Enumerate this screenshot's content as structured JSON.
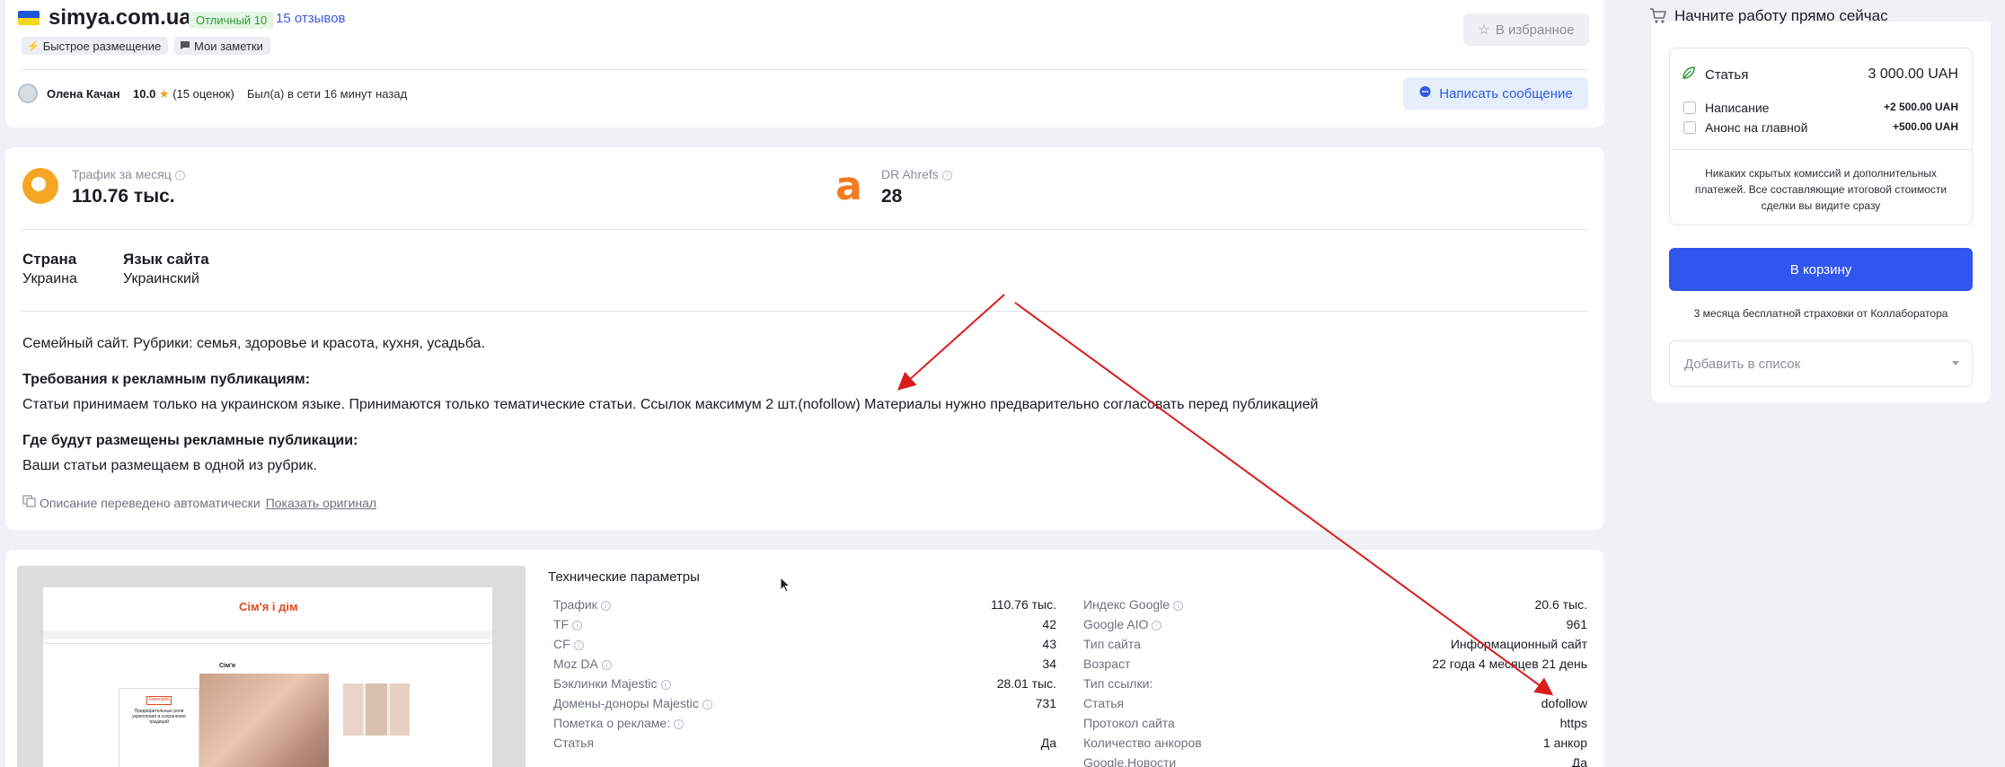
{
  "header": {
    "site_name": "simya.com.ua",
    "rating_badge": "Отличный 10",
    "reviews_link": "15 отзывов",
    "tags": [
      "Быстрое размещение",
      "Мои заметки"
    ],
    "favorite_label": "В избранное",
    "owner": {
      "name": "Олена Качан",
      "rating": "10.0",
      "rating_count": "(15 оценок)",
      "last_seen": "Был(а) в сети 16 минут назад"
    },
    "message_label": "Написать сообщение"
  },
  "metrics": {
    "traffic_label": "Трафик за месяц",
    "traffic_value": "110.76 тыс.",
    "dr_label": "DR Ahrefs",
    "dr_value": "28"
  },
  "site_info": {
    "country_label": "Страна",
    "country_value": "Украина",
    "language_label": "Язык сайта",
    "language_value": "Украинский"
  },
  "description": {
    "about": "Семейный сайт. Рубрики: семья, здоровье и красота, кухня, усадьба.",
    "requirements_title": "Требования к рекламным публикациям:",
    "requirements_text": "Статьи принимаем только на украинском языке. Принимаются только тематические статьи. Ссылок максимум 2 шт.(nofollow) Материалы нужно предварительно согласовать перед публикацией",
    "placement_title": "Где будут размещены рекламные публикации:",
    "placement_text": "Ваши статьи размещаем в одной из рубрик.",
    "translated_note": "Описание переведено автоматически",
    "show_original": "Показать оригинал"
  },
  "preview": {
    "logo_text": "Сім'я і дім",
    "section_title": "Сім'я",
    "article_title": "Предварительные роли укрепления и сохранение традиций",
    "small_label": "Категорія"
  },
  "tech": {
    "title": "Технические параметры",
    "left": [
      {
        "label": "Трафик",
        "value": "110.76 тыс.",
        "info": true
      },
      {
        "label": "TF",
        "value": "42",
        "info": true
      },
      {
        "label": "CF",
        "value": "43",
        "info": true
      },
      {
        "label": "Moz DA",
        "value": "34",
        "info": true
      },
      {
        "label": "Бэклинки Majestic",
        "value": "28.01 тыс.",
        "info": true
      },
      {
        "label": "Домены-доноры Majestic",
        "value": "731",
        "info": true
      },
      {
        "label": "Пометка о рекламе:",
        "value": "",
        "info": true
      },
      {
        "label": "Статья",
        "value": "Да",
        "info": false
      }
    ],
    "right": [
      {
        "label": "Индекс Google",
        "value": "20.6 тыс.",
        "info": true
      },
      {
        "label": "Google AIO",
        "value": "961",
        "info": true
      },
      {
        "label": "Тип сайта",
        "value": "Информационный сайт",
        "info": false
      },
      {
        "label": "Возраст",
        "value": "22 года 4 месяцев 21 день",
        "info": false
      },
      {
        "label": "Тип ссылки:",
        "value": "",
        "info": false
      },
      {
        "label": "Статья",
        "value": "dofollow",
        "info": false
      },
      {
        "label": "Протокол сайта",
        "value": "https",
        "info": false
      },
      {
        "label": "Количество анкоров",
        "value": "1 анкор",
        "info": false
      },
      {
        "label": "Google.Новости",
        "value": "Да",
        "info": false
      }
    ]
  },
  "sidebar": {
    "title": "Начните работу прямо сейчас",
    "article_label": "Статья",
    "article_price": "3 000.00 UAH",
    "options": [
      {
        "label": "Написание",
        "price": "+2 500.00 UAH"
      },
      {
        "label": "Анонс на главной",
        "price": "+500.00 UAH"
      }
    ],
    "no_fees_note": "Никаких скрытых комиссий и дополнительных платежей. Все составляющие итоговой стоимости сделки вы видите сразу",
    "cart_button": "В корзину",
    "insurance_note": "3 месяца бесплатной страховки от Коллаборатора",
    "add_to_list": "Добавить в список"
  },
  "colors": {
    "accent": "#3156ee",
    "annotation_arrow": "#d91c1c",
    "ahrefs_orange": "#f47a20",
    "semrush_orange": "#f5a623"
  }
}
